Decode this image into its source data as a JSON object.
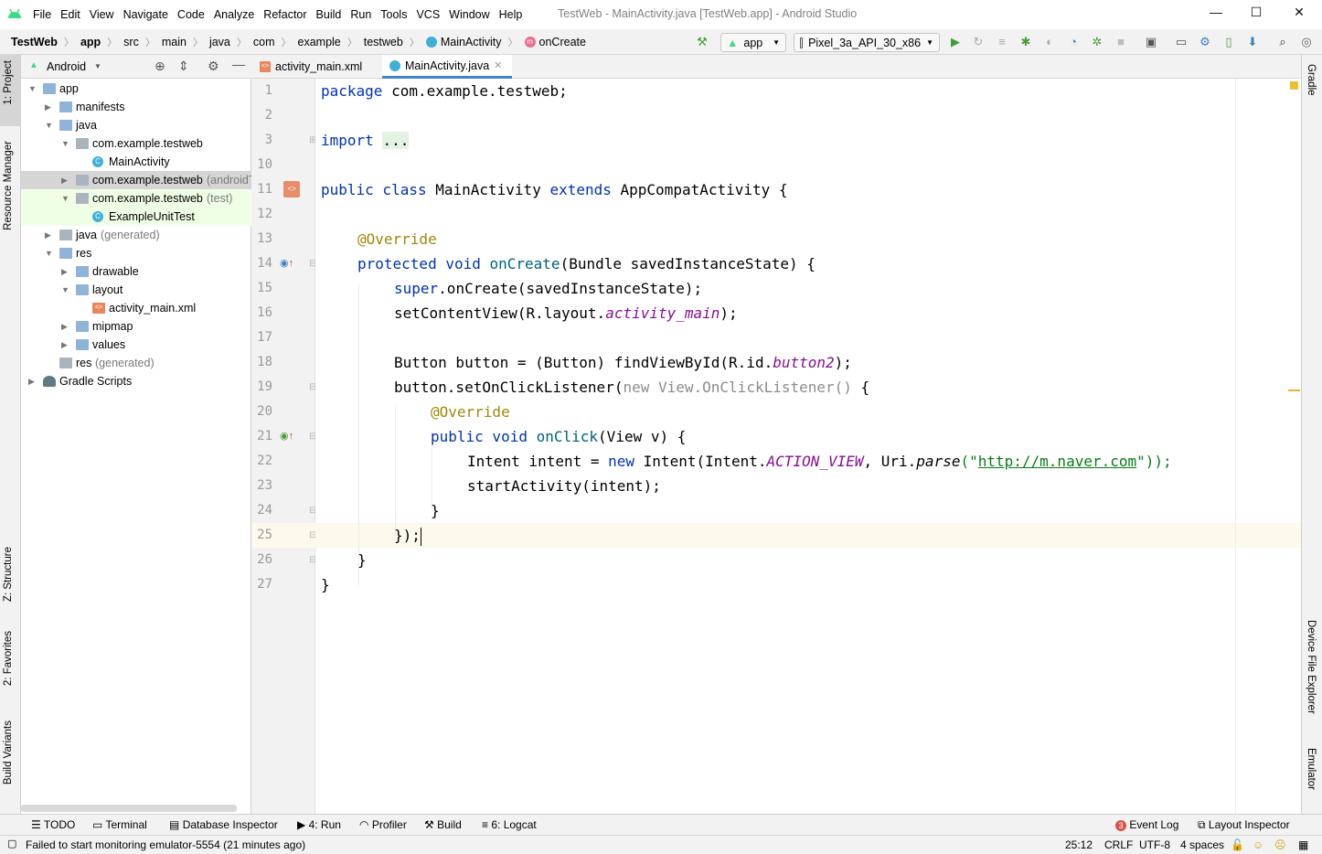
{
  "window": {
    "title": "TestWeb - MainActivity.java [TestWeb.app] - Android Studio",
    "menu": [
      "File",
      "Edit",
      "View",
      "Navigate",
      "Code",
      "Analyze",
      "Refactor",
      "Build",
      "Run",
      "Tools",
      "VCS",
      "Window",
      "Help"
    ],
    "controls": {
      "minimize": "—",
      "maximize": "☐",
      "close": "✕"
    }
  },
  "breadcrumb": [
    "TestWeb",
    "app",
    "src",
    "main",
    "java",
    "com",
    "example",
    "testweb",
    "MainActivity",
    "onCreate"
  ],
  "toolbar": {
    "run_config": "app",
    "device": "Pixel_3a_API_30_x86"
  },
  "left_stripe": {
    "project": "1: Project",
    "resource_manager": "Resource Manager",
    "structure": "Z: Structure",
    "favorites": "2: Favorites",
    "build_variants": "Build Variants"
  },
  "right_stripe": {
    "gradle": "Gradle",
    "device_file_explorer": "Device File Explorer",
    "emulator": "Emulator"
  },
  "project_panel": {
    "view_mode": "Android",
    "tree": [
      {
        "label": "app",
        "extra": "",
        "depth": 0,
        "arrow": "▼",
        "icon": "folder"
      },
      {
        "label": "manifests",
        "extra": "",
        "depth": 1,
        "arrow": "▶",
        "icon": "folder"
      },
      {
        "label": "java",
        "extra": "",
        "depth": 1,
        "arrow": "▼",
        "icon": "folder"
      },
      {
        "label": "com.example.testweb",
        "extra": "",
        "depth": 2,
        "arrow": "▼",
        "icon": "package"
      },
      {
        "label": "MainActivity",
        "extra": "",
        "depth": 3,
        "arrow": "",
        "icon": "class"
      },
      {
        "label": "com.example.testweb",
        "extra": "(androidTest)",
        "depth": 2,
        "arrow": "▶",
        "icon": "package"
      },
      {
        "label": "com.example.testweb",
        "extra": "(test)",
        "depth": 2,
        "arrow": "▼",
        "icon": "package"
      },
      {
        "label": "ExampleUnitTest",
        "extra": "",
        "depth": 3,
        "arrow": "",
        "icon": "class"
      },
      {
        "label": "java",
        "extra": "(generated)",
        "depth": 1,
        "arrow": "▶",
        "icon": "folder"
      },
      {
        "label": "res",
        "extra": "",
        "depth": 1,
        "arrow": "▼",
        "icon": "folder"
      },
      {
        "label": "drawable",
        "extra": "",
        "depth": 2,
        "arrow": "▶",
        "icon": "folder"
      },
      {
        "label": "layout",
        "extra": "",
        "depth": 2,
        "arrow": "▼",
        "icon": "folder"
      },
      {
        "label": "activity_main.xml",
        "extra": "",
        "depth": 3,
        "arrow": "",
        "icon": "xml"
      },
      {
        "label": "mipmap",
        "extra": "",
        "depth": 2,
        "arrow": "▶",
        "icon": "folder"
      },
      {
        "label": "values",
        "extra": "",
        "depth": 2,
        "arrow": "▶",
        "icon": "folder"
      },
      {
        "label": "res",
        "extra": "(generated)",
        "depth": 1,
        "arrow": "",
        "icon": "folder"
      },
      {
        "label": "Gradle Scripts",
        "extra": "",
        "depth": 0,
        "arrow": "▶",
        "icon": "gradle"
      }
    ]
  },
  "editor": {
    "tabs": [
      {
        "label": "activity_main.xml",
        "active": false
      },
      {
        "label": "MainActivity.java",
        "active": true
      }
    ],
    "line_numbers": [
      "1",
      "2",
      "3",
      "10",
      "11",
      "12",
      "13",
      "14",
      "15",
      "16",
      "17",
      "18",
      "19",
      "20",
      "21",
      "22",
      "23",
      "24",
      "25",
      "26",
      "27"
    ],
    "code": {
      "l1_kw": "package",
      "l1_rest": " com.example.testweb;",
      "l3_kw": "import",
      "l3_rest": "...",
      "l11_a": "public class",
      "l11_b": " MainActivity ",
      "l11_c": "extends",
      "l11_d": " AppCompatActivity {",
      "l13": "@Override",
      "l14_a": "protected void",
      "l14_b": " ",
      "l14_c": "onCreate",
      "l14_d": "(Bundle savedInstanceState) {",
      "l15_a": "super",
      "l15_b": ".onCreate(savedInstanceState);",
      "l16_a": "setContentView(R.layout.",
      "l16_b": "activity_main",
      "l16_c": ");",
      "l18_a": "Button button = (Button) findViewById(R.id.",
      "l18_b": "button2",
      "l18_c": ");",
      "l19_a": "button.setOnClickListener(",
      "l19_b": "new View.OnClickListener()",
      "l19_c": " {",
      "l20": "@Override",
      "l21_a": "public void",
      "l21_b": " ",
      "l21_c": "onClick",
      "l21_d": "(View v) {",
      "l22_a": "Intent intent = ",
      "l22_b": "new",
      "l22_c": " Intent(Intent.",
      "l22_d": "ACTION_VIEW",
      "l22_e": ", Uri.",
      "l22_f": "parse",
      "l22_g": "(\"",
      "l22_h": "http://m.naver.com",
      "l22_i": "\"));",
      "l23": "startActivity(intent);",
      "l24": "}",
      "l25": "});",
      "l26": "}",
      "l27": "}"
    }
  },
  "bottom_tools": [
    "TODO",
    "Terminal",
    "Database Inspector",
    "4: Run",
    "Profiler",
    "Build",
    "6: Logcat"
  ],
  "bottom_right_tools": {
    "event_log": "Event Log",
    "event_count": "3",
    "layout_inspector": "Layout Inspector"
  },
  "status": {
    "message": "Failed to start monitoring emulator-5554 (21 minutes ago)",
    "position": "25:12",
    "line_sep": "CRLF",
    "encoding": "UTF-8",
    "indent": "4 spaces"
  },
  "colors": {
    "keyword": "#0033b3",
    "annotation": "#9e880d",
    "field_italic": "#871094",
    "string": "#067d17",
    "current_line": "#fcfaed",
    "selected_tree_row": "#d5d5d5",
    "test_tree_row": "#efffe6"
  }
}
